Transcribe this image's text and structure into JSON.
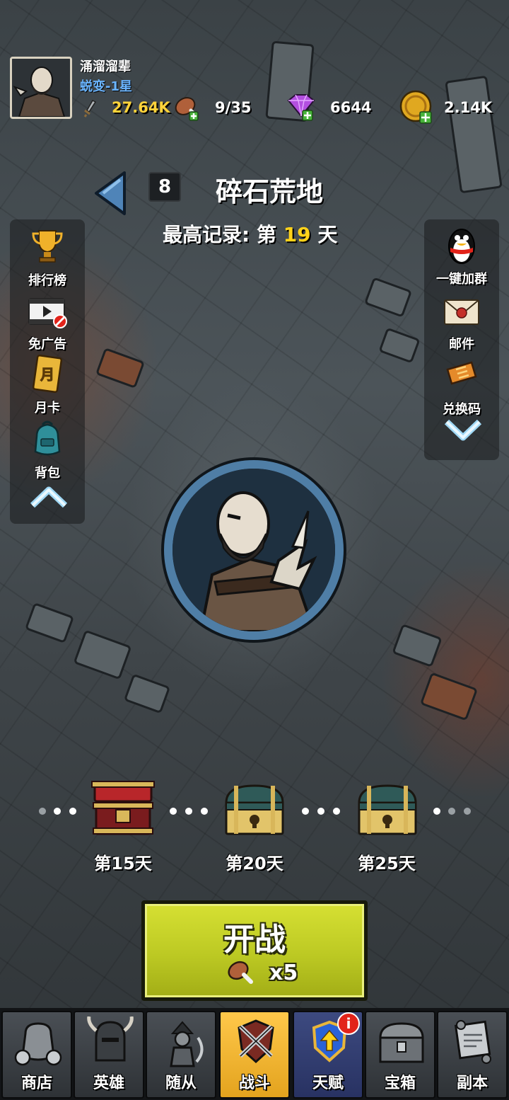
{
  "player": {
    "name": "涌溜溜辈",
    "rank": "蜕变-1星",
    "power": "27.64K"
  },
  "resources": {
    "stamina": "9/35",
    "gems": "6644",
    "gold": "2.14K"
  },
  "stage": {
    "number": "8",
    "name": "碎石荒地",
    "record_prefix": "最高记录: 第",
    "record_day": "19",
    "record_suffix": "天"
  },
  "left_menu": {
    "items": [
      {
        "label": "排行榜",
        "icon": "trophy-icon"
      },
      {
        "label": "免广告",
        "icon": "no-ads-icon"
      },
      {
        "label": "月卡",
        "icon": "month-card-icon"
      },
      {
        "label": "背包",
        "icon": "backpack-icon"
      }
    ]
  },
  "right_menu": {
    "items": [
      {
        "label": "一键加群",
        "icon": "qq-penguin-icon"
      },
      {
        "label": "邮件",
        "icon": "mail-icon"
      },
      {
        "label": "兑换码",
        "icon": "ticket-icon"
      }
    ]
  },
  "milestones": [
    {
      "label": "第15天",
      "state": "opened"
    },
    {
      "label": "第20天",
      "state": "locked"
    },
    {
      "label": "第25天",
      "state": "locked"
    }
  ],
  "fight_button": {
    "label": "开战",
    "cost": "x5"
  },
  "nav": {
    "tabs": [
      {
        "label": "商店",
        "icon": "shop-bag-icon"
      },
      {
        "label": "英雄",
        "icon": "knight-helmet-icon"
      },
      {
        "label": "随从",
        "icon": "follower-icon"
      },
      {
        "label": "战斗",
        "icon": "crossed-swords-icon",
        "active": true
      },
      {
        "label": "天赋",
        "icon": "talent-shield-icon"
      },
      {
        "label": "宝箱",
        "icon": "chest-icon"
      },
      {
        "label": "副本",
        "icon": "scroll-icon"
      }
    ],
    "talent_badge": "i"
  },
  "colors": {
    "rank": "#6ab4ff",
    "record_highlight": "#ffd21a",
    "fight_button": "#c5d12a",
    "active_tab": "#f2b83a"
  }
}
